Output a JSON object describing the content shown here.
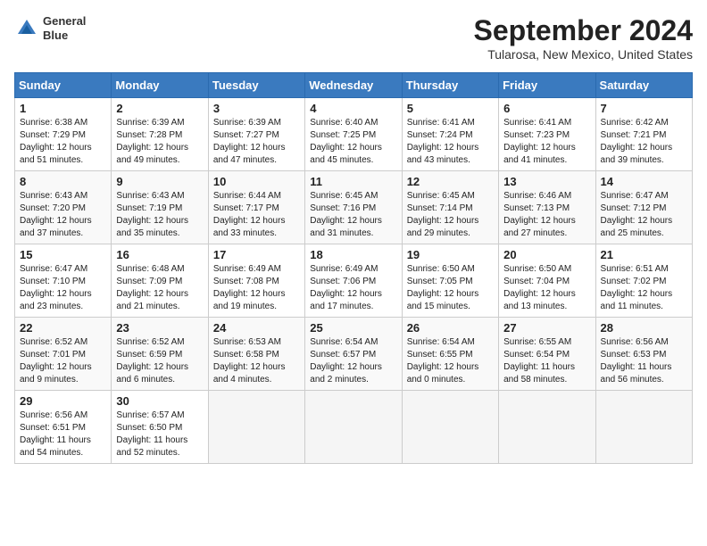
{
  "header": {
    "logo_line1": "General",
    "logo_line2": "Blue",
    "month": "September 2024",
    "location": "Tularosa, New Mexico, United States"
  },
  "columns": [
    "Sunday",
    "Monday",
    "Tuesday",
    "Wednesday",
    "Thursday",
    "Friday",
    "Saturday"
  ],
  "weeks": [
    [
      {
        "day": "1",
        "info": "Sunrise: 6:38 AM\nSunset: 7:29 PM\nDaylight: 12 hours\nand 51 minutes."
      },
      {
        "day": "2",
        "info": "Sunrise: 6:39 AM\nSunset: 7:28 PM\nDaylight: 12 hours\nand 49 minutes."
      },
      {
        "day": "3",
        "info": "Sunrise: 6:39 AM\nSunset: 7:27 PM\nDaylight: 12 hours\nand 47 minutes."
      },
      {
        "day": "4",
        "info": "Sunrise: 6:40 AM\nSunset: 7:25 PM\nDaylight: 12 hours\nand 45 minutes."
      },
      {
        "day": "5",
        "info": "Sunrise: 6:41 AM\nSunset: 7:24 PM\nDaylight: 12 hours\nand 43 minutes."
      },
      {
        "day": "6",
        "info": "Sunrise: 6:41 AM\nSunset: 7:23 PM\nDaylight: 12 hours\nand 41 minutes."
      },
      {
        "day": "7",
        "info": "Sunrise: 6:42 AM\nSunset: 7:21 PM\nDaylight: 12 hours\nand 39 minutes."
      }
    ],
    [
      {
        "day": "8",
        "info": "Sunrise: 6:43 AM\nSunset: 7:20 PM\nDaylight: 12 hours\nand 37 minutes."
      },
      {
        "day": "9",
        "info": "Sunrise: 6:43 AM\nSunset: 7:19 PM\nDaylight: 12 hours\nand 35 minutes."
      },
      {
        "day": "10",
        "info": "Sunrise: 6:44 AM\nSunset: 7:17 PM\nDaylight: 12 hours\nand 33 minutes."
      },
      {
        "day": "11",
        "info": "Sunrise: 6:45 AM\nSunset: 7:16 PM\nDaylight: 12 hours\nand 31 minutes."
      },
      {
        "day": "12",
        "info": "Sunrise: 6:45 AM\nSunset: 7:14 PM\nDaylight: 12 hours\nand 29 minutes."
      },
      {
        "day": "13",
        "info": "Sunrise: 6:46 AM\nSunset: 7:13 PM\nDaylight: 12 hours\nand 27 minutes."
      },
      {
        "day": "14",
        "info": "Sunrise: 6:47 AM\nSunset: 7:12 PM\nDaylight: 12 hours\nand 25 minutes."
      }
    ],
    [
      {
        "day": "15",
        "info": "Sunrise: 6:47 AM\nSunset: 7:10 PM\nDaylight: 12 hours\nand 23 minutes."
      },
      {
        "day": "16",
        "info": "Sunrise: 6:48 AM\nSunset: 7:09 PM\nDaylight: 12 hours\nand 21 minutes."
      },
      {
        "day": "17",
        "info": "Sunrise: 6:49 AM\nSunset: 7:08 PM\nDaylight: 12 hours\nand 19 minutes."
      },
      {
        "day": "18",
        "info": "Sunrise: 6:49 AM\nSunset: 7:06 PM\nDaylight: 12 hours\nand 17 minutes."
      },
      {
        "day": "19",
        "info": "Sunrise: 6:50 AM\nSunset: 7:05 PM\nDaylight: 12 hours\nand 15 minutes."
      },
      {
        "day": "20",
        "info": "Sunrise: 6:50 AM\nSunset: 7:04 PM\nDaylight: 12 hours\nand 13 minutes."
      },
      {
        "day": "21",
        "info": "Sunrise: 6:51 AM\nSunset: 7:02 PM\nDaylight: 12 hours\nand 11 minutes."
      }
    ],
    [
      {
        "day": "22",
        "info": "Sunrise: 6:52 AM\nSunset: 7:01 PM\nDaylight: 12 hours\nand 9 minutes."
      },
      {
        "day": "23",
        "info": "Sunrise: 6:52 AM\nSunset: 6:59 PM\nDaylight: 12 hours\nand 6 minutes."
      },
      {
        "day": "24",
        "info": "Sunrise: 6:53 AM\nSunset: 6:58 PM\nDaylight: 12 hours\nand 4 minutes."
      },
      {
        "day": "25",
        "info": "Sunrise: 6:54 AM\nSunset: 6:57 PM\nDaylight: 12 hours\nand 2 minutes."
      },
      {
        "day": "26",
        "info": "Sunrise: 6:54 AM\nSunset: 6:55 PM\nDaylight: 12 hours\nand 0 minutes."
      },
      {
        "day": "27",
        "info": "Sunrise: 6:55 AM\nSunset: 6:54 PM\nDaylight: 11 hours\nand 58 minutes."
      },
      {
        "day": "28",
        "info": "Sunrise: 6:56 AM\nSunset: 6:53 PM\nDaylight: 11 hours\nand 56 minutes."
      }
    ],
    [
      {
        "day": "29",
        "info": "Sunrise: 6:56 AM\nSunset: 6:51 PM\nDaylight: 11 hours\nand 54 minutes."
      },
      {
        "day": "30",
        "info": "Sunrise: 6:57 AM\nSunset: 6:50 PM\nDaylight: 11 hours\nand 52 minutes."
      },
      {
        "day": "",
        "info": ""
      },
      {
        "day": "",
        "info": ""
      },
      {
        "day": "",
        "info": ""
      },
      {
        "day": "",
        "info": ""
      },
      {
        "day": "",
        "info": ""
      }
    ]
  ]
}
